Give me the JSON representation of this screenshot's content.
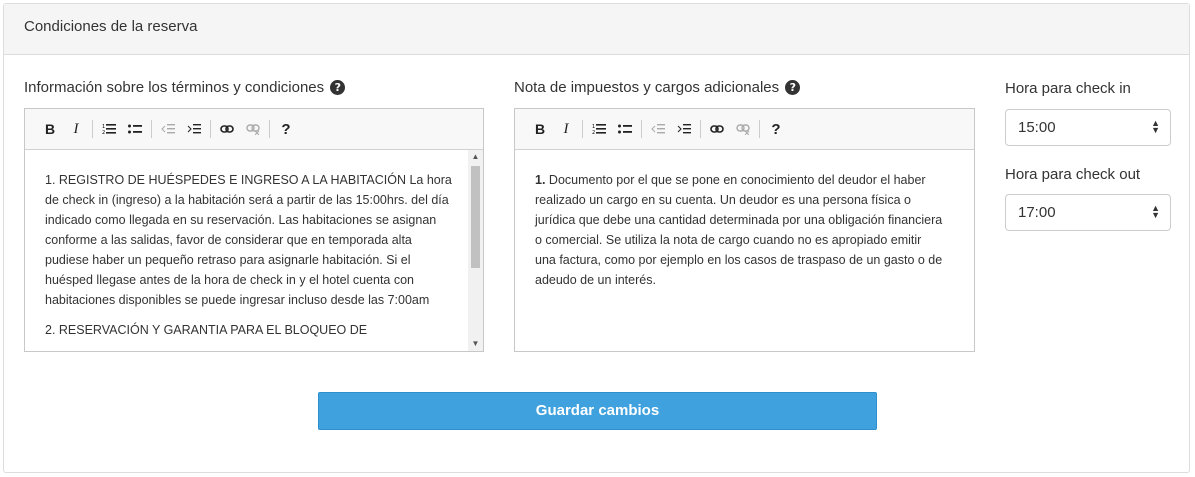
{
  "panel": {
    "title": "Condiciones de la reserva"
  },
  "terms": {
    "label": "Información sobre los términos y condiciones",
    "paragraph1": "1. REGISTRO DE HUÉSPEDES E INGRESO A LA HABITACIÓN La hora de check in (ingreso) a la habitación será a partir de las 15:00hrs. del día indicado como llegada en su reservación. Las habitaciones se asignan conforme a las salidas, favor de considerar que en temporada alta pudiese haber un pequeño retraso para asignarle habitación. Si el huésped llegase antes de la hora de check in y el hotel cuenta con habitaciones disponibles se puede ingresar incluso desde las 7:00am",
    "paragraph2": "2. RESERVACIÓN Y GARANTIA PARA EL BLOQUEO DE"
  },
  "taxes": {
    "label": "Nota de impuestos y cargos adicionales",
    "number": "1.",
    "text": " Documento por el que se pone en conocimiento del deudor el haber realizado un cargo en su cuenta. Un deudor es una persona física o jurídica que debe una cantidad determinada por una obligación financiera o comercial. Se utiliza la nota de cargo cuando no es apropiado emitir una factura, como por ejemplo en los casos de traspaso de un gasto o de adeudo de un interés."
  },
  "checkin": {
    "label": "Hora para check in",
    "value": "15:00"
  },
  "checkout": {
    "label": "Hora para check out",
    "value": "17:00"
  },
  "toolbar": {
    "bold": "B",
    "italic": "I",
    "help": "?"
  },
  "save_button": "Guardar cambios",
  "colors": {
    "button": "#3fa1de",
    "header_bg": "#f5f5f5"
  }
}
